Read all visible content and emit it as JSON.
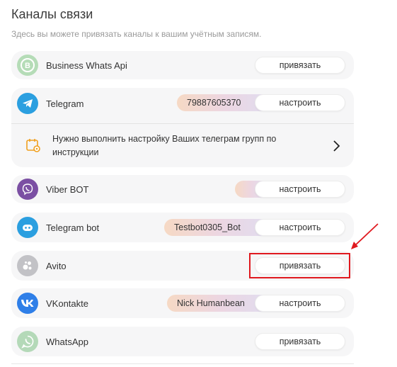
{
  "header": {
    "title": "Каналы связи",
    "subtitle": "Здесь вы можете привязать каналы к вашим учётным записям."
  },
  "channels": [
    {
      "name": "Business Whats Api",
      "button": "привязать",
      "icon": "whatsapp-business-icon"
    },
    {
      "name": "Telegram",
      "badge": "79887605370",
      "button": "настроить",
      "icon": "telegram-icon"
    },
    {
      "name": "Viber BOT",
      "badge": "",
      "button": "настроить",
      "icon": "viber-icon"
    },
    {
      "name": "Telegram bot",
      "badge": "Testbot0305_Bot",
      "button": "настроить",
      "icon": "telegram-bot-icon"
    },
    {
      "name": "Avito",
      "button": "привязать",
      "icon": "avito-icon"
    },
    {
      "name": "VKontakte",
      "badge": "Nick Humanbean",
      "button": "настроить",
      "icon": "vk-icon"
    },
    {
      "name": "WhatsApp",
      "button": "привязать",
      "icon": "whatsapp-icon"
    }
  ],
  "telegram_notice": {
    "text": "Нужно выполнить настройку Ваших телеграм групп по инструкции",
    "icon": "calendar-gear-icon"
  },
  "colors": {
    "highlight": "#e0191f",
    "telegram": "#2b9fe0",
    "viber": "#7b4fa3",
    "vk": "#2f7fe8",
    "whatsapp_muted": "#b4d9b8"
  }
}
